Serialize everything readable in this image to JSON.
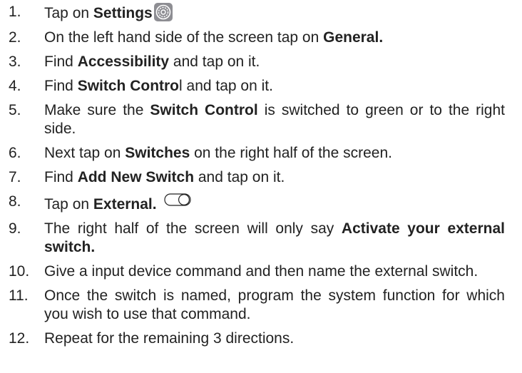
{
  "steps": [
    {
      "num": "1.",
      "pre": "Tap on ",
      "bold": "Settings",
      "post": "",
      "icon": "settings-gear-icon"
    },
    {
      "num": "2.",
      "pre": "On the left hand side of the screen tap on ",
      "bold": "General.",
      "post": ""
    },
    {
      "num": "3.",
      "pre": "Find ",
      "bold": "Accessibility",
      "post": " and tap on it."
    },
    {
      "num": "4.",
      "pre": "Find ",
      "bold": "Switch Contro",
      "post": "l and tap on it."
    },
    {
      "num": "5.",
      "pre": "Make sure the ",
      "bold": "Switch Control",
      "post": " is switched to green or to the right side."
    },
    {
      "num": "6.",
      "pre": "Next tap on ",
      "bold": "Switches",
      "post": " on the right half of the screen."
    },
    {
      "num": "7.",
      "pre": "Find ",
      "bold": "Add New Switch",
      "post": " and tap on it."
    },
    {
      "num": "8.",
      "pre": "Tap on ",
      "bold": "External.",
      "post": "",
      "icon": "toggle-switch-icon"
    },
    {
      "num": "9.",
      "pre": "The right half of the screen will only say ",
      "bold": "Activate your external switch.",
      "post": ""
    },
    {
      "num": "10.",
      "pre": "Give a input device command and then name the external switch.",
      "bold": "",
      "post": ""
    },
    {
      "num": "11.",
      "pre": "Once the switch is named, program the system function for which you wish to use that command.",
      "bold": "",
      "post": ""
    },
    {
      "num": "12.",
      "pre": "Repeat for the remaining 3 directions.",
      "bold": "",
      "post": ""
    }
  ],
  "colors": {
    "text": "#222222",
    "settings_icon_bg": "#8e8e93"
  }
}
